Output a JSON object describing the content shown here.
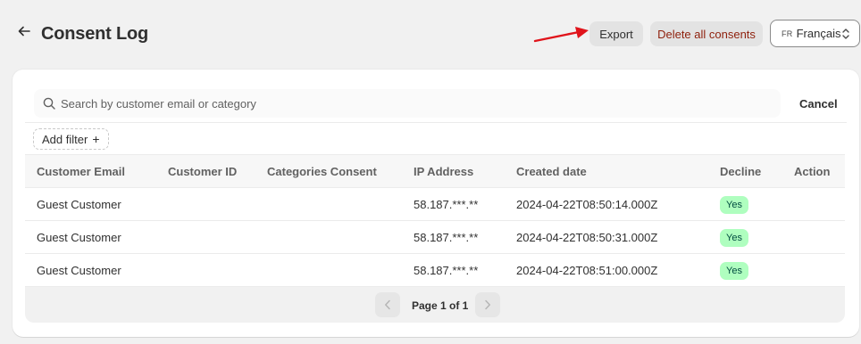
{
  "header": {
    "title": "Consent Log",
    "export_label": "Export",
    "delete_label": "Delete all consents",
    "language": {
      "code": "FR",
      "label": "Français"
    }
  },
  "search": {
    "placeholder": "Search by customer email or category",
    "value": "",
    "cancel_label": "Cancel"
  },
  "filter": {
    "add_label": "Add filter",
    "plus": "+"
  },
  "table": {
    "columns": [
      "Customer Email",
      "Customer ID",
      "Categories Consent",
      "IP Address",
      "Created date",
      "Decline",
      "Action"
    ],
    "rows": [
      {
        "email": "Guest Customer",
        "customer_id": "",
        "categories": "",
        "ip": "58.187.***.**",
        "created": "2024-04-22T08:50:14.000Z",
        "decline": "Yes",
        "action": ""
      },
      {
        "email": "Guest Customer",
        "customer_id": "",
        "categories": "",
        "ip": "58.187.***.**",
        "created": "2024-04-22T08:50:31.000Z",
        "decline": "Yes",
        "action": ""
      },
      {
        "email": "Guest Customer",
        "customer_id": "",
        "categories": "",
        "ip": "58.187.***.**",
        "created": "2024-04-22T08:51:00.000Z",
        "decline": "Yes",
        "action": ""
      }
    ]
  },
  "pagination": {
    "label": "Page 1 of 1"
  },
  "icons": {
    "back": "arrow-left-icon",
    "search": "search-icon",
    "select_chevron": "chevron-up-down-icon",
    "prev": "chevron-left-icon",
    "next": "chevron-right-icon",
    "annotation": "red-arrow-icon"
  },
  "colors": {
    "background": "#f1f1f1",
    "card": "#ffffff",
    "delete_text": "#8e1f0b",
    "badge_bg": "#affebf",
    "badge_text": "#014b40",
    "annotation_arrow": "#e0141b"
  }
}
